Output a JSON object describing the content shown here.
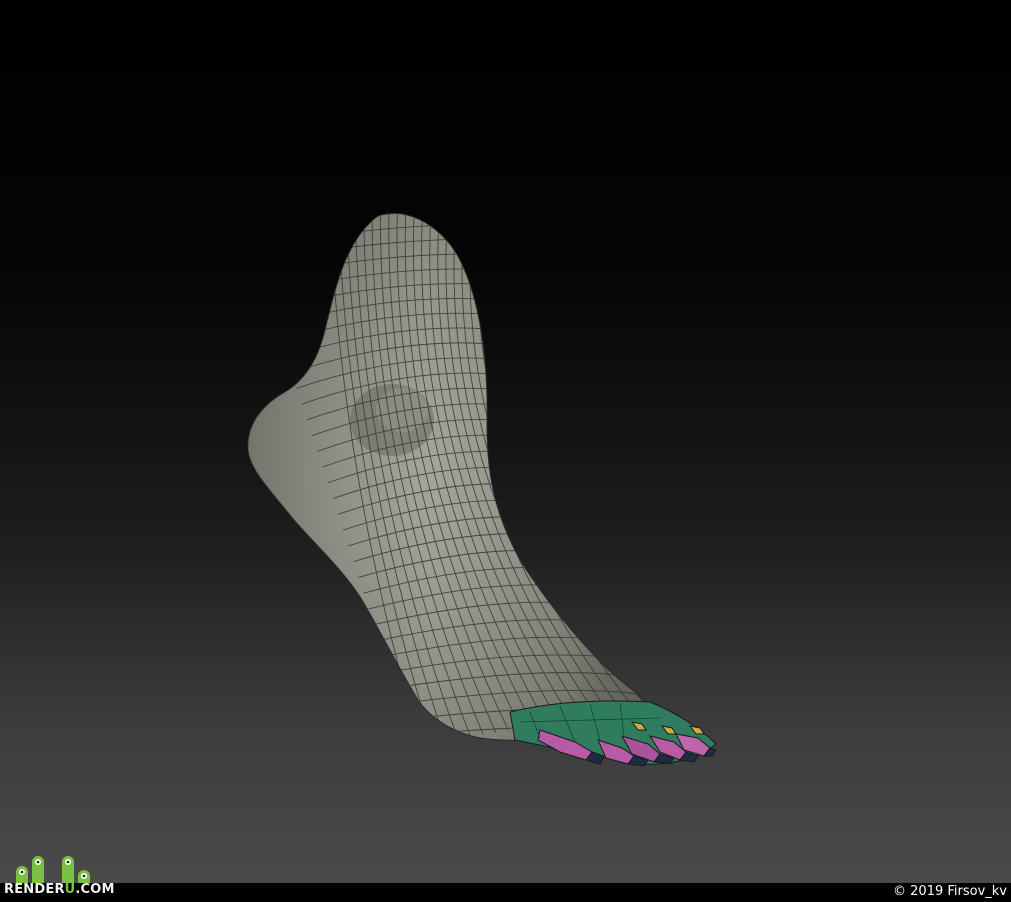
{
  "scene": {
    "subject_icon": "foot-mesh-render",
    "background_top": "#000000",
    "background_bottom": "#4a4a4a",
    "mesh_color": "#8a8c80",
    "toe_colors": [
      "#2f7d5e",
      "#b85aa6",
      "#1f2a44"
    ]
  },
  "watermark": {
    "brand_main": "RENDER",
    "brand_accent": "U",
    "brand_suffix": ".COM",
    "accent_color": "#7ac143"
  },
  "footer": {
    "copyright": "© 2019 Firsov_kv"
  }
}
